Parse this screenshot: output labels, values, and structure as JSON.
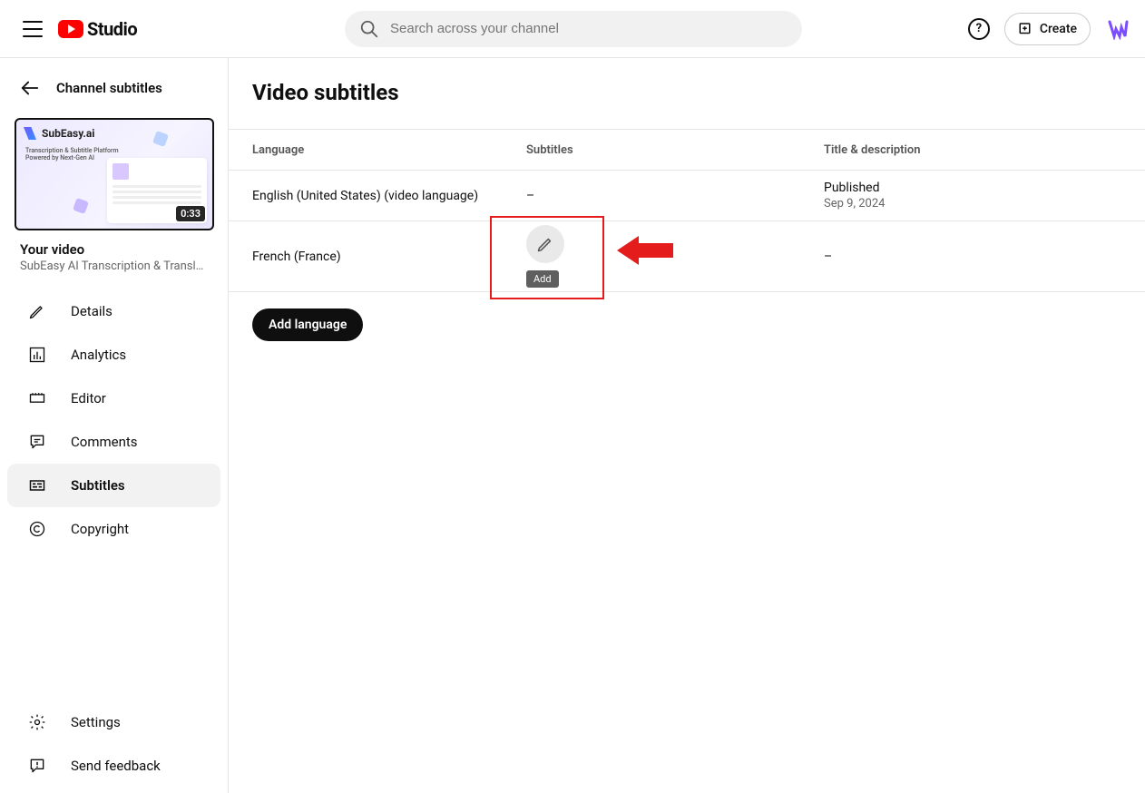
{
  "header": {
    "studio_label": "Studio",
    "search_placeholder": "Search across your channel",
    "create_label": "Create"
  },
  "sidebar": {
    "back_label": "Channel subtitles",
    "video_thumb": {
      "title": "SubEasy.ai",
      "subtitle_line1": "Transcription & Subtitle Platform",
      "subtitle_line2": "Powered by Next-Gen AI",
      "duration": "0:33"
    },
    "your_video_label": "Your video",
    "video_title": "SubEasy AI Transcription & Translati…",
    "nav": {
      "details": "Details",
      "analytics": "Analytics",
      "editor": "Editor",
      "comments": "Comments",
      "subtitles": "Subtitles",
      "copyright": "Copyright"
    },
    "bottom": {
      "settings": "Settings",
      "feedback": "Send feedback"
    }
  },
  "main": {
    "page_title": "Video subtitles",
    "columns": {
      "language": "Language",
      "subtitles": "Subtitles",
      "title_desc": "Title & description"
    },
    "rows": [
      {
        "language": "English (United States) (video language)",
        "subtitles": "–",
        "td_status": "Published",
        "td_date": "Sep 9, 2024"
      },
      {
        "language": "French (France)",
        "add_tooltip": "Add",
        "td_status": "–"
      }
    ],
    "add_language": "Add language"
  }
}
